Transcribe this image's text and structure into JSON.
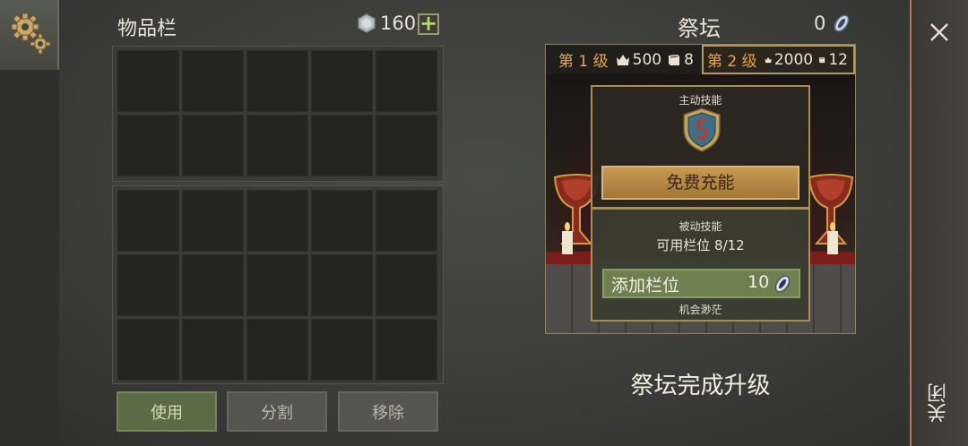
{
  "inventory": {
    "title": "物品栏",
    "silver_count": "160",
    "add_label": "+",
    "grid_top_rows": 2,
    "grid_bottom_rows": 3,
    "columns": 5,
    "buttons": {
      "use": "使用",
      "split": "分割",
      "remove": "移除"
    }
  },
  "altar": {
    "title": "祭坛",
    "crystal_count": "0",
    "levels": [
      {
        "name": "第 1 级",
        "crowns": "500",
        "books": "8"
      },
      {
        "name": "第 2 级",
        "crowns": "2000",
        "books": "12"
      }
    ],
    "active_skill": {
      "label": "主动技能",
      "button": "免费充能"
    },
    "passive_skill": {
      "label": "被动技能",
      "slots_available": "可用栏位 8/12",
      "add_slot_label": "添加栏位",
      "add_slot_cost": "10",
      "chance_text": "机会渺茫"
    },
    "upgrade_status": "祭坛完成升级"
  },
  "close": {
    "x_label": "×",
    "text": "关闭"
  },
  "colors": {
    "accent_gold": "#c89a52",
    "level_orange": "#e6a44a",
    "green_button": "#6f8050",
    "close_rail_border": "#b77560"
  }
}
